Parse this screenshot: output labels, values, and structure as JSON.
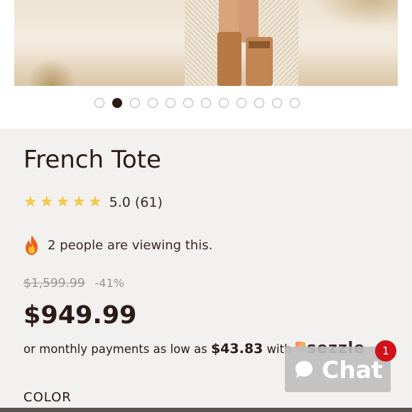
{
  "product": {
    "title": "French Tote",
    "rating": {
      "stars": 5,
      "text": "5.0 (61)"
    },
    "viewing": {
      "icon": "fire-icon",
      "text": "2 people are viewing this."
    },
    "compare_price": "$1,599.99",
    "discount": "-41%",
    "price": "$949.99",
    "installments": {
      "prefix": "or monthly payments as low as",
      "amount": "$43.83",
      "suffix": "with",
      "provider": "sezzle"
    },
    "color_label": "COLOR"
  },
  "gallery": {
    "slide_count": 12,
    "active_slide": 2
  },
  "chat": {
    "label": "Chat",
    "badge": "1"
  },
  "colors": {
    "accent_text": "#2b1b17",
    "star": "#f2c94c",
    "badge": "#d0121b"
  }
}
